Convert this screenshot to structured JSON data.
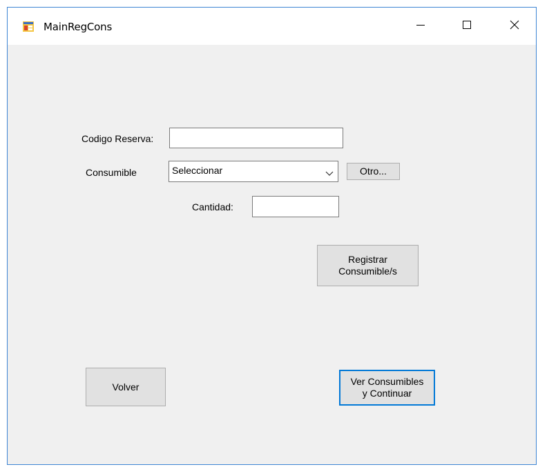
{
  "window": {
    "title": "MainRegCons",
    "icon": "windows-form-icon",
    "minimize_icon": "minimize-icon",
    "maximize_icon": "maximize-icon",
    "close_icon": "close-icon"
  },
  "form": {
    "codigo_reserva": {
      "label": "Codigo Reserva:",
      "value": ""
    },
    "consumible": {
      "label": "Consumible",
      "selected": "Seleccionar"
    },
    "otro_button": "Otro...",
    "cantidad": {
      "label": "Cantidad:",
      "value": ""
    },
    "registrar_button": {
      "line1": "Registrar",
      "line2": "Consumible/s"
    },
    "volver_button": "Volver",
    "ver_button": {
      "line1": "Ver Consumibles",
      "line2": "y Continuar"
    }
  },
  "colors": {
    "window_border": "#3c84d3",
    "form_background": "#f0f0f0",
    "button_face": "#e1e1e1",
    "focus_accent": "#0078d7"
  }
}
